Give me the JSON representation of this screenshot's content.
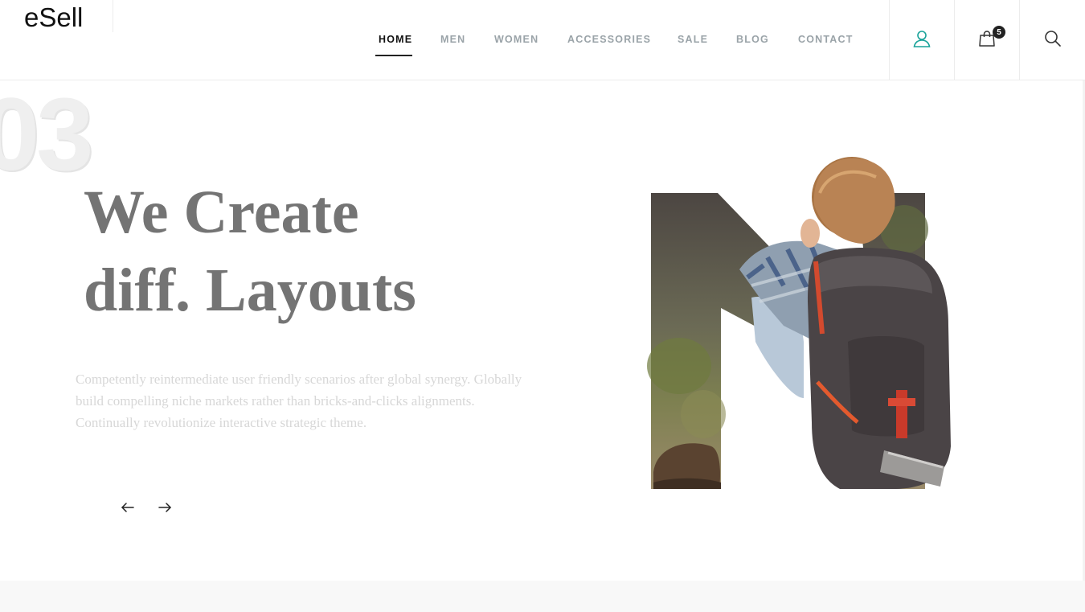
{
  "brand": {
    "logo_text": "eSell"
  },
  "nav": {
    "items": [
      {
        "label": "HOME",
        "active": true
      },
      {
        "label": "MEN",
        "active": false
      },
      {
        "label": "WOMEN",
        "active": false
      },
      {
        "label": "ACCESSORIES",
        "active": false
      },
      {
        "label": "SALE",
        "active": false
      },
      {
        "label": "BLOG",
        "active": false
      },
      {
        "label": "CONTACT",
        "active": false
      }
    ]
  },
  "header_actions": {
    "account_icon": "user-icon",
    "cart_icon": "shopping-bag-icon",
    "cart_count": "5",
    "search_icon": "search-icon"
  },
  "hero": {
    "slide_number": "03",
    "headline_line1": "We Create",
    "headline_line2": "diff. Layouts",
    "description": "Competently reintermediate user friendly scenarios after global synergy. Globally build compelling niche markets rather than bricks-and-clicks alignments. Continually revolutionize interactive strategic theme.",
    "prev_icon": "arrow-left-icon",
    "next_icon": "arrow-right-icon",
    "image_icon": "letter-n-photo-collage"
  },
  "colors": {
    "accent": "#1aa39a",
    "headline": "#747474",
    "nav_inactive": "#9aa3a8",
    "nav_active": "#111111"
  }
}
